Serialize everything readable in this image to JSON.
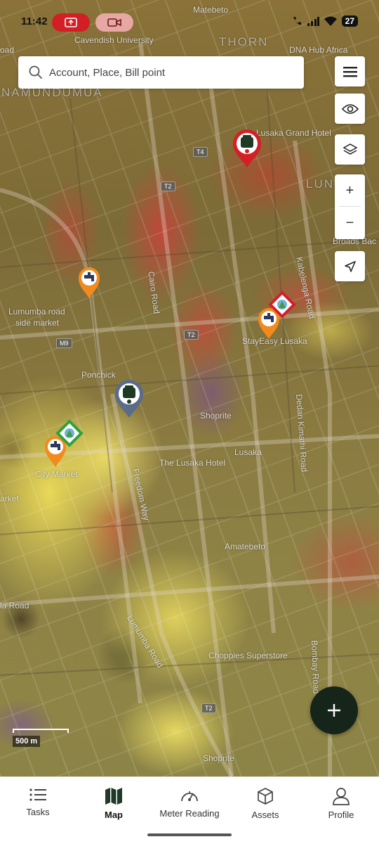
{
  "status_bar": {
    "time": "11:42",
    "battery": "27",
    "icons": [
      "screen-share-icon",
      "video-call-icon",
      "wifi-calling-icon",
      "signal-icon",
      "wifi-icon",
      "battery-icon"
    ]
  },
  "search": {
    "placeholder": "Account, Place, Bill point"
  },
  "map_controls": {
    "menu": "menu-icon",
    "visibility": "eye-icon",
    "layers": "layers-icon",
    "zoom_in": "+",
    "zoom_out": "−",
    "locate": "navigation-icon"
  },
  "map": {
    "labels": {
      "matebeto": "Matebeto",
      "cavendish": "Cavendish University",
      "thorn_park": "THORN\nPARK",
      "dna_hub": "DNA Hub Africa",
      "namununua": "NAMUNDUMUA",
      "road_top_left": "oad",
      "lusaka_grand": "Lusaka Grand Hotel",
      "lun": "LUN",
      "broads": "Broads Bac",
      "lumumba_market": "Lumumba road\nside market",
      "ponchick": "Ponchick",
      "stayeasy": "StayEasy Lusaka",
      "shoprite1": "Shoprite",
      "lusaka": "Lusaka",
      "lusaka_hotel": "The Lusaka Hotel",
      "city_market": "City Market",
      "arket": "arket",
      "amatebeto": "Amatebeto",
      "la_road": "la Road",
      "choppies": "Choppies Superstore",
      "shoprite2": "Shoprite",
      "cairo_road": "Cairo Road",
      "freedom_way": "Freedom Way",
      "lumumba_road": "Lumumba Road",
      "kabelenga": "Kabelenga Road",
      "dedan": "Dedan Kimathi Road",
      "bombay": "Bombay Road",
      "shield_t4": "T4",
      "shield_t2a": "T2",
      "shield_t2b": "T2",
      "shield_m9": "M9",
      "shield_t2c": "T2",
      "shield_t2d": "T2"
    },
    "scale": "500 m"
  },
  "fab": {
    "label": "+"
  },
  "nav": {
    "items": [
      {
        "label": "Tasks",
        "icon": "list-icon"
      },
      {
        "label": "Map",
        "icon": "map-icon"
      },
      {
        "label": "Meter Reading",
        "icon": "gauge-icon"
      },
      {
        "label": "Assets",
        "icon": "cube-icon"
      },
      {
        "label": "Profile",
        "icon": "person-icon"
      }
    ],
    "active": "Map"
  }
}
